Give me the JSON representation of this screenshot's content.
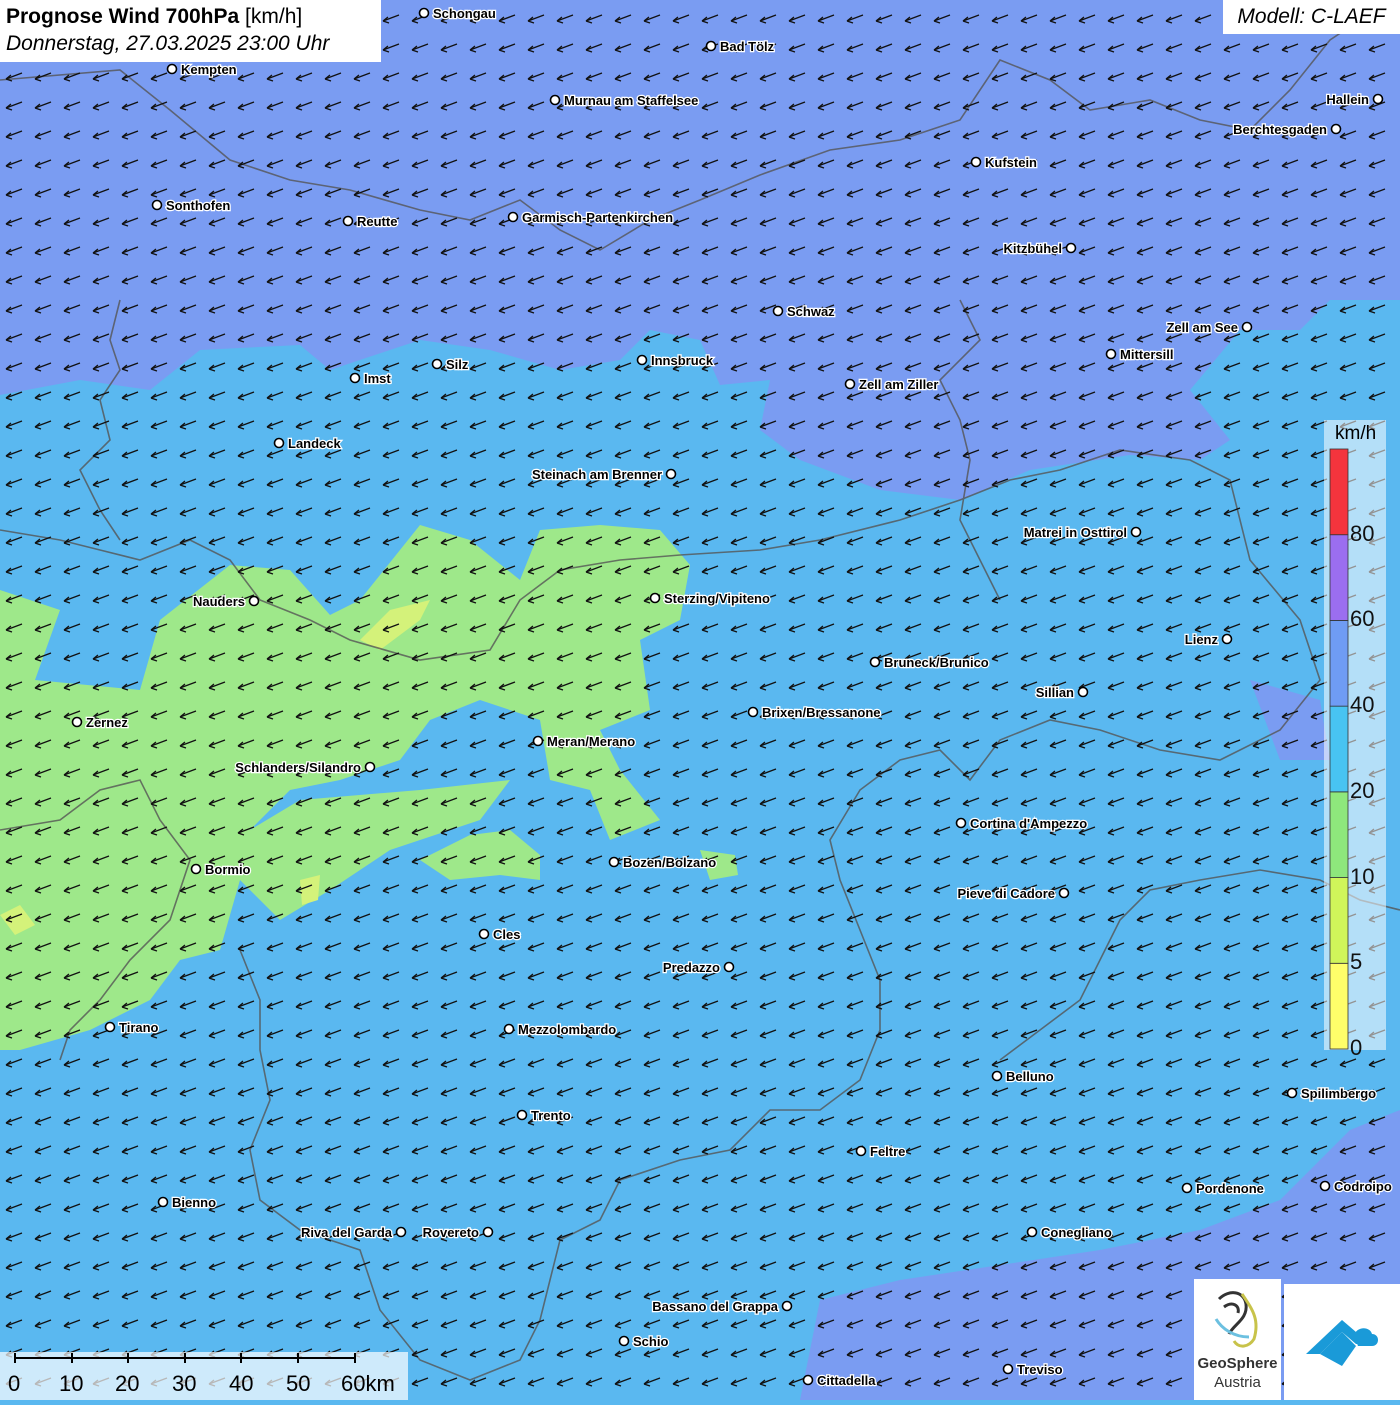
{
  "header": {
    "title": "Prognose Wind 700hPa",
    "unit": "[km/h]",
    "datetime": "Donnerstag, 27.03.2025 23:00 Uhr",
    "model": "Modell: C-LAEF"
  },
  "legend": {
    "unit": "km/h",
    "values": [
      "0",
      "5",
      "10",
      "20",
      "40",
      "60",
      "80"
    ],
    "colors": [
      "#fffe6a",
      "#d0f55a",
      "#8ee77c",
      "#48c4f2",
      "#6f9cf4",
      "#9b6ef0",
      "#f4343d"
    ]
  },
  "scale": {
    "labels": [
      "0",
      "10",
      "20",
      "30",
      "40",
      "50",
      "60km"
    ]
  },
  "logo": {
    "line1": "GeoSphere",
    "line2": "Austria"
  },
  "colors": {
    "background_speed_20_40": "#5ab8f0",
    "speed_40_60": "#7a9cf2",
    "speed_10_20": "#9ee88a",
    "speed_5_10": "#d4f27a",
    "borders": "#555555"
  },
  "cities": [
    {
      "name": "Schongau"
    },
    {
      "name": "Bad Tölz"
    },
    {
      "name": "Kempten"
    },
    {
      "name": "Murnau am Staffelsee"
    },
    {
      "name": "Hallein"
    },
    {
      "name": "Berchtesgaden"
    },
    {
      "name": "Kufstein"
    },
    {
      "name": "Sonthofen"
    },
    {
      "name": "Reutte"
    },
    {
      "name": "Garmisch-Partenkirchen"
    },
    {
      "name": "Kitzbühel"
    },
    {
      "name": "Schwaz"
    },
    {
      "name": "Zell am See"
    },
    {
      "name": "Mittersill"
    },
    {
      "name": "Innsbruck"
    },
    {
      "name": "Silz"
    },
    {
      "name": "Imst"
    },
    {
      "name": "Zell am Ziller"
    },
    {
      "name": "Landeck"
    },
    {
      "name": "Steinach am Brenner"
    },
    {
      "name": "Matrei in Osttirol"
    },
    {
      "name": "Nauders"
    },
    {
      "name": "Sterzing/Vipiteno"
    },
    {
      "name": "Lienz"
    },
    {
      "name": "Bruneck/Brunico"
    },
    {
      "name": "Sillian"
    },
    {
      "name": "Brixen/Bressanone"
    },
    {
      "name": "Zernez"
    },
    {
      "name": "Meran/Merano"
    },
    {
      "name": "Schlanders/Silandro"
    },
    {
      "name": "Cortina d'Ampezzo"
    },
    {
      "name": "Bozen/Bolzano"
    },
    {
      "name": "Bormio"
    },
    {
      "name": "Pieve di Cadore"
    },
    {
      "name": "Cles"
    },
    {
      "name": "Predazzo"
    },
    {
      "name": "Tirano"
    },
    {
      "name": "Mezzolombardo"
    },
    {
      "name": "Belluno"
    },
    {
      "name": "Spilimbergo"
    },
    {
      "name": "Trento"
    },
    {
      "name": "Feltre"
    },
    {
      "name": "Pordenone"
    },
    {
      "name": "Codroipo"
    },
    {
      "name": "Bienno"
    },
    {
      "name": "Riva del Garda"
    },
    {
      "name": "Rovereto"
    },
    {
      "name": "Conegliano"
    },
    {
      "name": "Bassano del Grappa"
    },
    {
      "name": "Schio"
    },
    {
      "name": "Treviso"
    },
    {
      "name": "Cittadella"
    }
  ]
}
